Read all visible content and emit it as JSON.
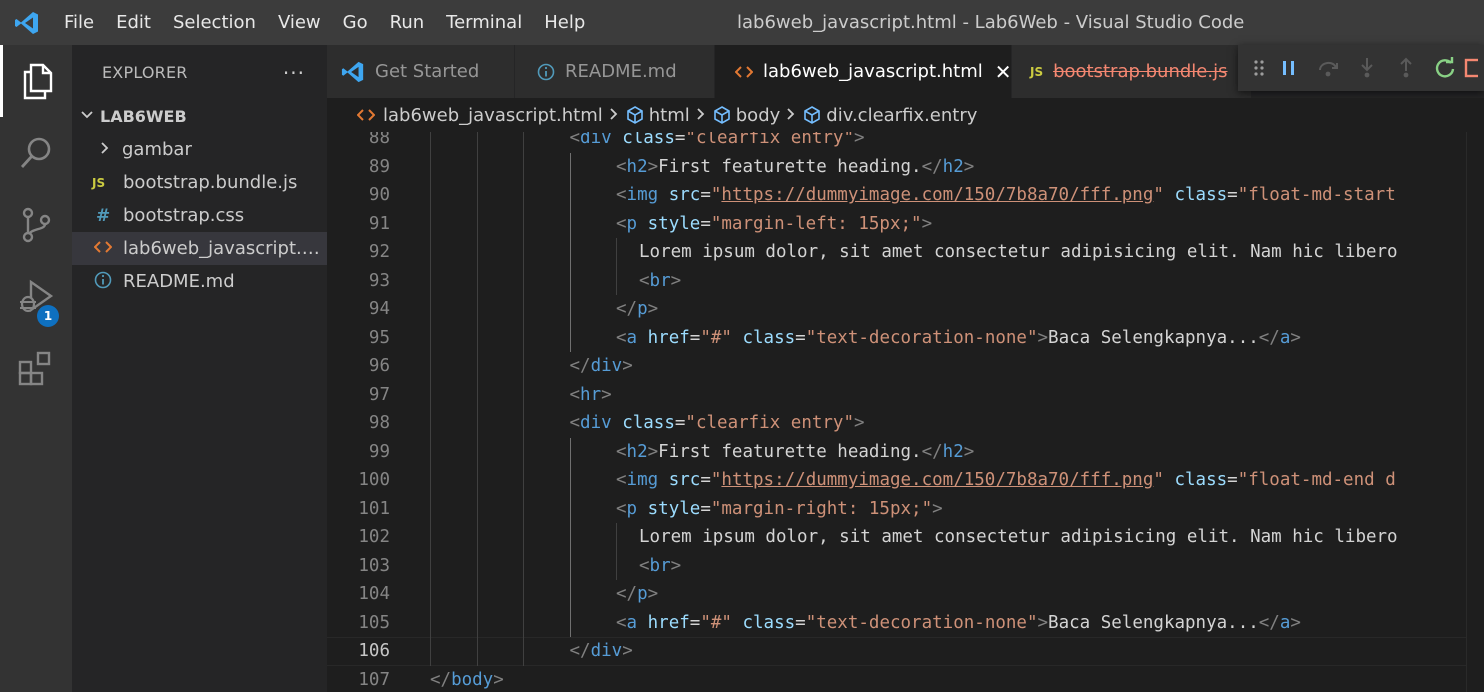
{
  "titlebar": {
    "menu": [
      "File",
      "Edit",
      "Selection",
      "View",
      "Go",
      "Run",
      "Terminal",
      "Help"
    ],
    "window_title": "lab6web_javascript.html - Lab6Web - Visual Studio Code"
  },
  "activitybar": {
    "items": [
      "explorer-icon",
      "search-icon",
      "source-control-icon",
      "run-debug-icon",
      "extensions-icon"
    ],
    "debug_badge": "1"
  },
  "sidebar": {
    "title": "EXPLORER",
    "more": "···",
    "folder": "LAB6WEB",
    "items": [
      {
        "icon": ">",
        "label": "gambar",
        "type": "folder"
      },
      {
        "icon": "JS",
        "label": "bootstrap.bundle.js",
        "type": "js"
      },
      {
        "icon": "#",
        "label": "bootstrap.css",
        "type": "css"
      },
      {
        "icon": "<>",
        "label": "lab6web_javascript.html",
        "type": "html"
      },
      {
        "icon": "i",
        "label": "README.md",
        "type": "info"
      }
    ]
  },
  "tabs": [
    {
      "label": "Get Started",
      "icon": "vscode-icon"
    },
    {
      "label": "README.md",
      "icon": "info-icon"
    },
    {
      "label": "lab6web_javascript.html",
      "icon": "html-icon",
      "close": "✕"
    },
    {
      "label": "bootstrap.bundle.js",
      "icon": "JS"
    }
  ],
  "debug_toolbar": [
    "drag-handle-icon",
    "pause-icon",
    "step-over-icon",
    "step-into-icon",
    "step-out-icon",
    "restart-icon",
    "stop-icon"
  ],
  "breadcrumb": [
    "lab6web_javascript.html",
    "html",
    "body",
    "div.clearfix.entry"
  ],
  "editor": {
    "lines": [
      {
        "n": "88",
        "indent": 3,
        "tokens": [
          [
            "b",
            "<"
          ],
          [
            "g",
            "div"
          ],
          [
            "a",
            " class"
          ],
          [
            "t",
            "="
          ],
          [
            "s",
            "\"clearfix entry\""
          ],
          [
            "b",
            ">"
          ]
        ]
      },
      {
        "n": "89",
        "indent": 4,
        "tokens": [
          [
            "b",
            "<"
          ],
          [
            "g",
            "h2"
          ],
          [
            "b",
            ">"
          ],
          [
            "t",
            "First featurette heading."
          ],
          [
            "b",
            "</"
          ],
          [
            "g",
            "h2"
          ],
          [
            "b",
            ">"
          ]
        ]
      },
      {
        "n": "90",
        "indent": 4,
        "tokens": [
          [
            "b",
            "<"
          ],
          [
            "g",
            "img"
          ],
          [
            "a",
            " src"
          ],
          [
            "t",
            "="
          ],
          [
            "s",
            "\""
          ],
          [
            "u",
            "https://dummyimage.com/150/7b8a70/fff.png"
          ],
          [
            "s",
            "\""
          ],
          [
            "a",
            " class"
          ],
          [
            "t",
            "="
          ],
          [
            "s",
            "\"float-md-start"
          ]
        ]
      },
      {
        "n": "91",
        "indent": 4,
        "tokens": [
          [
            "b",
            "<"
          ],
          [
            "g",
            "p"
          ],
          [
            "a",
            " style"
          ],
          [
            "t",
            "="
          ],
          [
            "s",
            "\"margin-left: 15px;\""
          ],
          [
            "b",
            ">"
          ]
        ]
      },
      {
        "n": "92",
        "indent": 5,
        "tokens": [
          [
            "t",
            "Lorem ipsum dolor, sit amet consectetur adipisicing elit. Nam hic libero"
          ]
        ]
      },
      {
        "n": "93",
        "indent": 5,
        "tokens": [
          [
            "b",
            "<"
          ],
          [
            "g",
            "br"
          ],
          [
            "b",
            ">"
          ]
        ]
      },
      {
        "n": "94",
        "indent": 4,
        "tokens": [
          [
            "b",
            "</"
          ],
          [
            "g",
            "p"
          ],
          [
            "b",
            ">"
          ]
        ]
      },
      {
        "n": "95",
        "indent": 4,
        "tokens": [
          [
            "b",
            "<"
          ],
          [
            "g",
            "a"
          ],
          [
            "a",
            " href"
          ],
          [
            "t",
            "="
          ],
          [
            "s",
            "\"#\""
          ],
          [
            "a",
            " class"
          ],
          [
            "t",
            "="
          ],
          [
            "s",
            "\"text-decoration-none\""
          ],
          [
            "b",
            ">"
          ],
          [
            "t",
            "Baca Selengkapnya..."
          ],
          [
            "b",
            "</"
          ],
          [
            "g",
            "a"
          ],
          [
            "b",
            ">"
          ]
        ]
      },
      {
        "n": "96",
        "indent": 3,
        "tokens": [
          [
            "b",
            "</"
          ],
          [
            "g",
            "div"
          ],
          [
            "b",
            ">"
          ]
        ]
      },
      {
        "n": "97",
        "indent": 3,
        "tokens": [
          [
            "b",
            "<"
          ],
          [
            "g",
            "hr"
          ],
          [
            "b",
            ">"
          ]
        ]
      },
      {
        "n": "98",
        "indent": 3,
        "tokens": [
          [
            "b",
            "<"
          ],
          [
            "g",
            "div"
          ],
          [
            "a",
            " class"
          ],
          [
            "t",
            "="
          ],
          [
            "s",
            "\"clearfix entry\""
          ],
          [
            "b",
            ">"
          ]
        ]
      },
      {
        "n": "99",
        "indent": 4,
        "tokens": [
          [
            "b",
            "<"
          ],
          [
            "g",
            "h2"
          ],
          [
            "b",
            ">"
          ],
          [
            "t",
            "First featurette heading."
          ],
          [
            "b",
            "</"
          ],
          [
            "g",
            "h2"
          ],
          [
            "b",
            ">"
          ]
        ]
      },
      {
        "n": "100",
        "indent": 4,
        "tokens": [
          [
            "b",
            "<"
          ],
          [
            "g",
            "img"
          ],
          [
            "a",
            " src"
          ],
          [
            "t",
            "="
          ],
          [
            "s",
            "\""
          ],
          [
            "u",
            "https://dummyimage.com/150/7b8a70/fff.png"
          ],
          [
            "s",
            "\""
          ],
          [
            "a",
            " class"
          ],
          [
            "t",
            "="
          ],
          [
            "s",
            "\"float-md-end d"
          ]
        ]
      },
      {
        "n": "101",
        "indent": 4,
        "tokens": [
          [
            "b",
            "<"
          ],
          [
            "g",
            "p"
          ],
          [
            "a",
            " style"
          ],
          [
            "t",
            "="
          ],
          [
            "s",
            "\"margin-right: 15px;\""
          ],
          [
            "b",
            ">"
          ]
        ]
      },
      {
        "n": "102",
        "indent": 5,
        "tokens": [
          [
            "t",
            "Lorem ipsum dolor, sit amet consectetur adipisicing elit. Nam hic libero"
          ]
        ]
      },
      {
        "n": "103",
        "indent": 5,
        "tokens": [
          [
            "b",
            "<"
          ],
          [
            "g",
            "br"
          ],
          [
            "b",
            ">"
          ]
        ]
      },
      {
        "n": "104",
        "indent": 4,
        "tokens": [
          [
            "b",
            "</"
          ],
          [
            "g",
            "p"
          ],
          [
            "b",
            ">"
          ]
        ]
      },
      {
        "n": "105",
        "indent": 4,
        "tokens": [
          [
            "b",
            "<"
          ],
          [
            "g",
            "a"
          ],
          [
            "a",
            " href"
          ],
          [
            "t",
            "="
          ],
          [
            "s",
            "\"#\""
          ],
          [
            "a",
            " class"
          ],
          [
            "t",
            "="
          ],
          [
            "s",
            "\"text-decoration-none\""
          ],
          [
            "b",
            ">"
          ],
          [
            "t",
            "Baca Selengkapnya..."
          ],
          [
            "b",
            "</"
          ],
          [
            "g",
            "a"
          ],
          [
            "b",
            ">"
          ]
        ]
      },
      {
        "n": "106",
        "indent": 3,
        "current": true,
        "tokens": [
          [
            "b",
            "</"
          ],
          [
            "g",
            "div"
          ],
          [
            "b",
            ">"
          ]
        ]
      },
      {
        "n": "107",
        "indent": 0,
        "tokens": [
          [
            "b",
            "</"
          ],
          [
            "g",
            "body"
          ],
          [
            "b",
            ">"
          ]
        ]
      }
    ]
  },
  "colors": {
    "accent": "#0e70c0",
    "tag": "#569cd6",
    "attribute": "#9cdcfe",
    "string": "#ce9178",
    "deleted_file": "#f48771"
  }
}
